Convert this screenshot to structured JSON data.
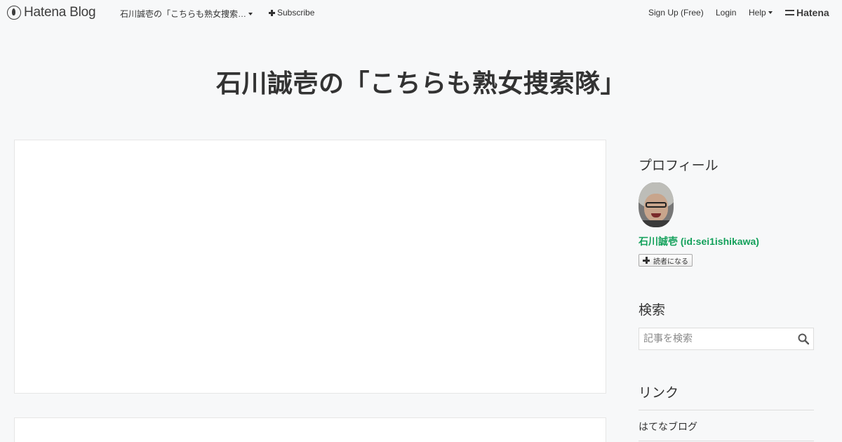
{
  "header": {
    "logo_text": "Hatena Blog",
    "blog_selector": "石川誠壱の「こちらも熟女捜索…",
    "subscribe_label": "Subscribe",
    "signup_label": "Sign Up (Free)",
    "login_label": "Login",
    "help_label": "Help",
    "hatena_label": "Hatena"
  },
  "blog": {
    "title": "石川誠壱の「こちらも熟女捜索隊」"
  },
  "sidebar": {
    "profile": {
      "heading": "プロフィール",
      "name": "石川誠壱 (id:sei1ishikawa)",
      "reader_button": "読者になる"
    },
    "search": {
      "heading": "検索",
      "placeholder": "記事を検索"
    },
    "links": {
      "heading": "リンク",
      "items": [
        "はてなブログ"
      ]
    }
  },
  "colors": {
    "background": "#f7f8f9",
    "profile_name": "#12a05a",
    "text": "#333333"
  }
}
